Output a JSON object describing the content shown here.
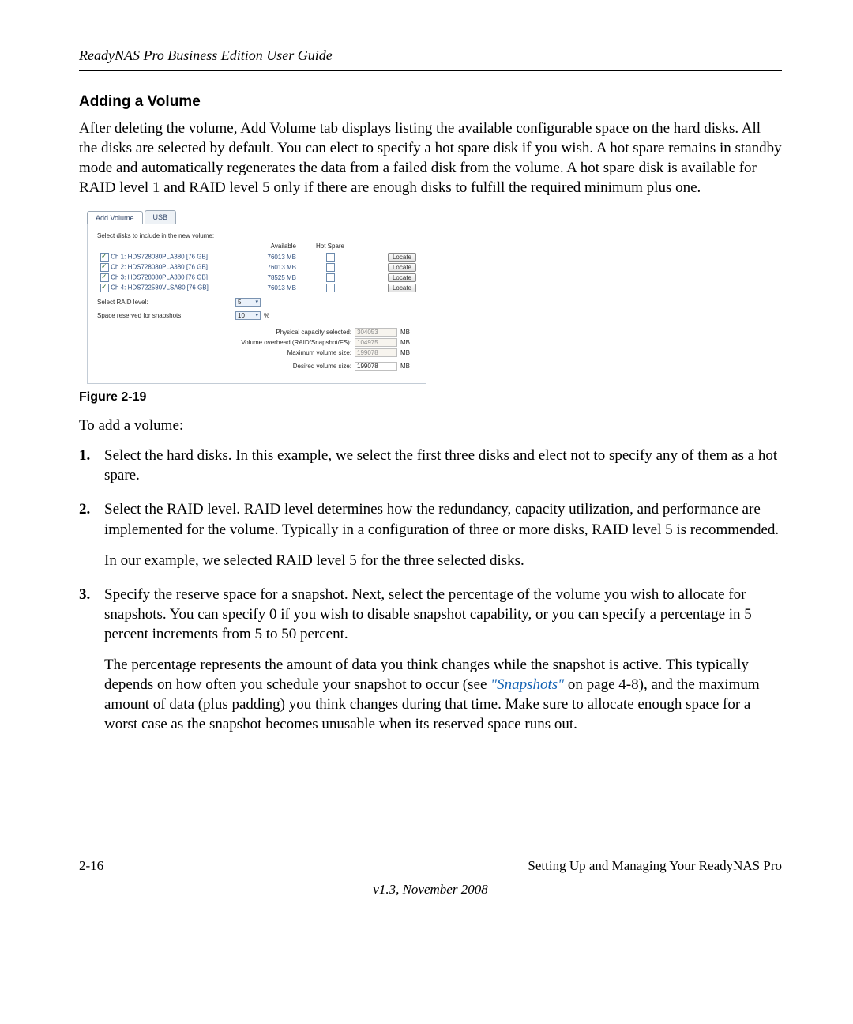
{
  "header": {
    "title": "ReadyNAS Pro Business Edition User Guide"
  },
  "section": {
    "heading": "Adding a Volume",
    "intro": "After deleting the volume, Add Volume tab displays listing the available configurable space on the hard disks. All the disks are selected by default. You can elect to specify a hot spare disk if you wish. A hot spare remains in standby mode and automatically regenerates the data from a failed disk from the volume. A hot spare disk is available for RAID level 1 and RAID level 5 only if there are enough disks to fulfill the required minimum plus one."
  },
  "screenshot": {
    "tabs": {
      "active": "Add Volume",
      "other": "USB"
    },
    "panel_label": "Select disks to include in the new volume:",
    "columns": {
      "available": "Available",
      "hotspare": "Hot Spare"
    },
    "disks": [
      {
        "name": "Ch 1: HDS728080PLA380 [76 GB]",
        "available": "76013 MB",
        "checked": true
      },
      {
        "name": "Ch 2: HDS728080PLA380 [76 GB]",
        "available": "76013 MB",
        "checked": true
      },
      {
        "name": "Ch 3: HDS728080PLA380 [76 GB]",
        "available": "78525 MB",
        "checked": true
      },
      {
        "name": "Ch 4: HDS722580VLSA80 [76 GB]",
        "available": "76013 MB",
        "checked": true
      }
    ],
    "locate_label": "Locate",
    "raid_label": "Select RAID level:",
    "raid_value": "5",
    "snapshot_label": "Space reserved for snapshots:",
    "snapshot_value": "10",
    "snapshot_unit": "%",
    "summary": {
      "physical_label": "Physical capacity selected:",
      "physical_value": "304053",
      "overhead_label": "Volume overhead (RAID/Snapshot/FS):",
      "overhead_value": "104975",
      "max_label": "Maximum volume size:",
      "max_value": "199078",
      "desired_label": "Desired volume size:",
      "desired_value": "199078",
      "unit": "MB"
    }
  },
  "figure_caption": "Figure 2-19",
  "lead_in": "To add a volume:",
  "steps": {
    "s1": "Select the hard disks. In this example, we select the first three disks and elect not to specify any of them as a hot spare.",
    "s2": "Select the RAID level. RAID level determines how the redundancy, capacity utilization, and performance are implemented for the volume. Typically in a configuration of three or more disks, RAID level 5 is recommended.",
    "s2b": "In our example, we selected RAID level 5 for the three selected disks.",
    "s3a": "Specify the reserve space for a snapshot. Next, select the percentage of the volume you wish to allocate for snapshots. You can specify 0 if you wish to disable snapshot capability, or you can specify a percentage in 5 percent increments from 5 to 50 percent.",
    "s3b_pre": "The percentage represents the amount of data you think changes while the snapshot is active. This typically depends on how often you schedule your snapshot to occur (see ",
    "s3b_link": "\"Snapshots\"",
    "s3b_post": " on page 4-8), and the maximum amount of data (plus padding) you think changes during that time. Make sure to allocate enough space for a worst case as the snapshot becomes unusable when its reserved space runs out."
  },
  "footer": {
    "page": "2-16",
    "chapter": "Setting Up and Managing Your ReadyNAS Pro",
    "version": "v1.3, November 2008"
  }
}
